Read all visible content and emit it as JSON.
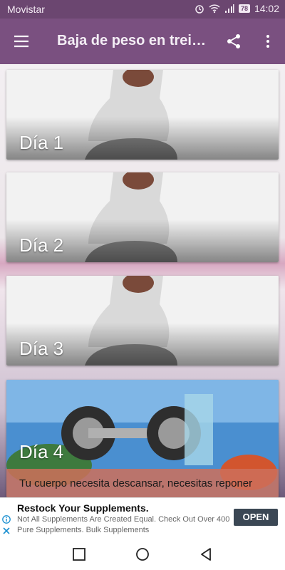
{
  "status_bar": {
    "carrier": "Movistar",
    "battery": "78",
    "time": "14:02"
  },
  "toolbar": {
    "title": "Baja de peso en treinta días",
    "menu_icon": "hamburger-menu-icon",
    "share_icon": "share-icon",
    "more_icon": "more-vert-icon"
  },
  "days": [
    {
      "label": "Día 1"
    },
    {
      "label": "Día 2"
    },
    {
      "label": "Día 3"
    },
    {
      "label": "Día 4",
      "description": "Tu cuerpo necesita descansar, necesitas reponer"
    }
  ],
  "ad": {
    "title": "Restock Your Supplements.",
    "text": "Not All Supplements Are Created Equal. Check Out Over 400 Pure Supplements. Bulk Supplements",
    "button": "OPEN"
  },
  "colors": {
    "status_bar": "#6b4670",
    "toolbar": "#7a5080",
    "ad_button": "#3b4754"
  }
}
